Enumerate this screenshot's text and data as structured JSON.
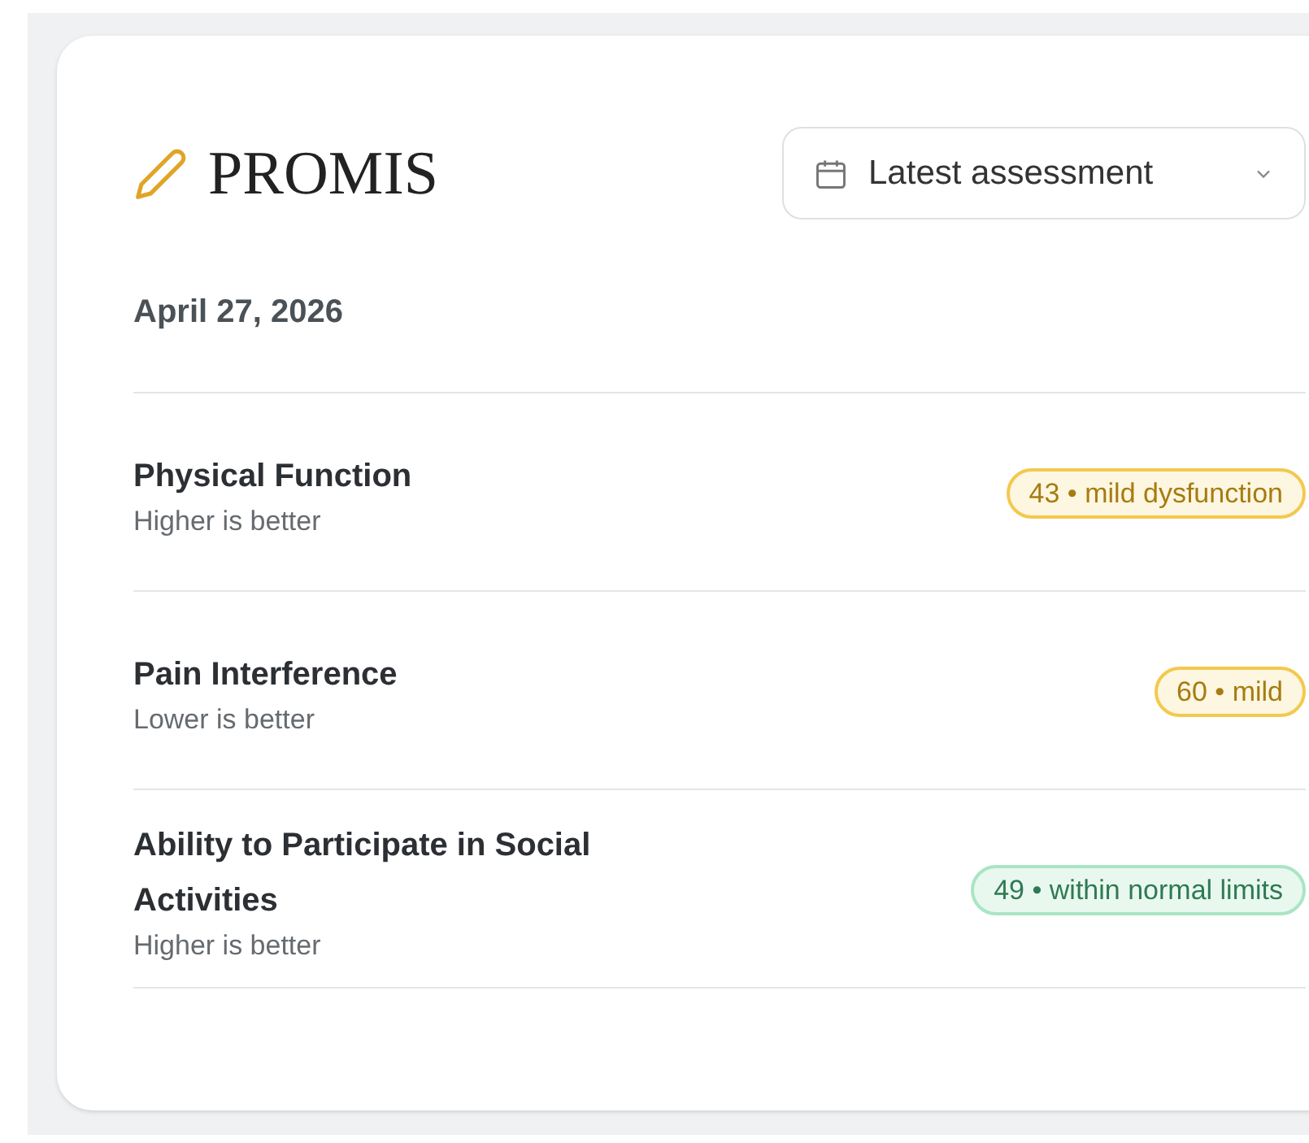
{
  "card": {
    "title": "PROMIS",
    "filter": {
      "label": "Latest assessment"
    },
    "date": "April 27, 2026",
    "rows": [
      {
        "name": "Physical Function",
        "hint": "Higher is better",
        "badge": "43 • mild dysfunction",
        "kind": "warning"
      },
      {
        "name": "Pain Interference",
        "hint": "Lower is better",
        "badge": "60 • mild",
        "kind": "warning"
      },
      {
        "name": "Ability to Participate in Social Activities",
        "hint": "Higher is better",
        "badge": "49 • within normal limits",
        "kind": "normal"
      }
    ]
  }
}
